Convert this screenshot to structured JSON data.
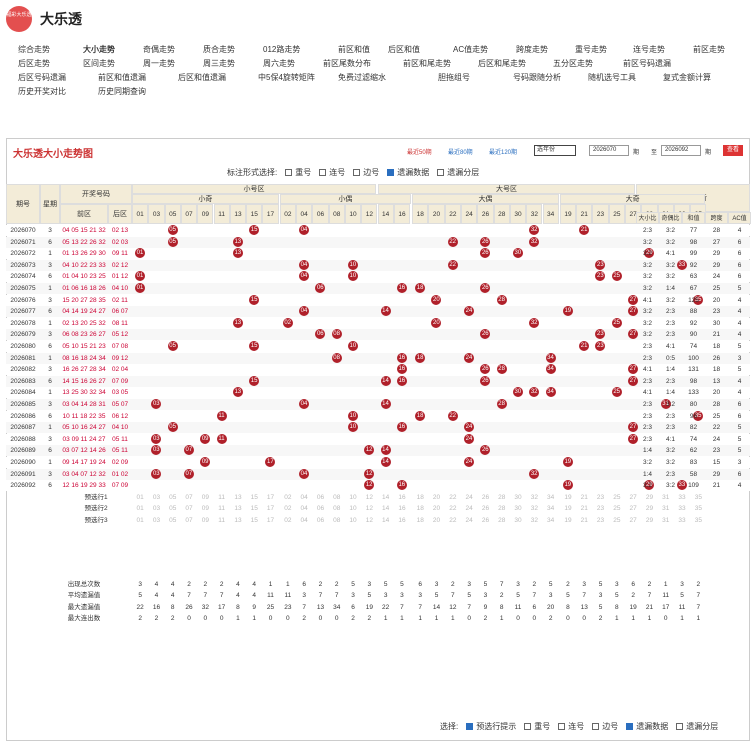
{
  "header": {
    "logo_text": "福彩大乐透",
    "title": "大乐透"
  },
  "nav": [
    [
      "综合走势",
      "大小走势",
      "奇偶走势",
      "质合走势",
      "012路走势",
      "前区和值",
      "后区和值",
      "AC值走势",
      "跨度走势",
      "重号走势",
      "连号走势",
      "前区走势"
    ],
    [
      "后区走势",
      "区间走势",
      "周一走势",
      "周三走势",
      "周六走势",
      "前区尾数分布",
      "前区和尾走势",
      "后区和尾走势",
      "五分区走势",
      "前区号码遗漏"
    ],
    [
      "后区号码遗漏",
      "前区和值遗漏",
      "后区和值遗漏",
      "中5保4旋转矩阵",
      "免费过滤缩水",
      "胆拖组号",
      "号码跟随分析",
      "随机选号工具",
      "复式金额计算"
    ],
    [
      "历史开奖对比",
      "历史同期查询"
    ]
  ],
  "panel": {
    "title": "大乐透大小走势图",
    "recent": [
      "最近50期",
      "最近80期",
      "最近120期"
    ],
    "year": "选年份",
    "from": "2026070",
    "period": "期",
    "to_label": "至",
    "to": "2026092",
    "period2": "期",
    "query": "查看",
    "options_label": "标注形式选择:",
    "options": [
      "重号",
      "连号",
      "边号",
      "遗漏数据",
      "遗漏分层"
    ],
    "bottom_label": "选择:",
    "bottom_options": [
      "预选行提示",
      "重号",
      "连号",
      "边号",
      "遗漏数据",
      "遗漏分层"
    ]
  },
  "table": {
    "head_groups": {
      "small": "小号区",
      "big": "大号区",
      "analysis": "前区分析",
      "draw": "开奖号码",
      "issue": "期号",
      "week": "星期",
      "front": "前区",
      "back": "后区"
    },
    "sub_groups": [
      "小奇",
      "小偶",
      "大偶",
      "大奇"
    ],
    "analysis_cols": [
      "大小比",
      "奇偶比",
      "和值",
      "跨度",
      "AC值"
    ],
    "numbers": [
      "01",
      "03",
      "05",
      "07",
      "09",
      "11",
      "13",
      "15",
      "17",
      "02",
      "04",
      "06",
      "08",
      "10",
      "12",
      "14",
      "16",
      "18",
      "20",
      "22",
      "24",
      "26",
      "28",
      "30",
      "32",
      "34",
      "19",
      "21",
      "23",
      "25",
      "27",
      "29",
      "31",
      "33",
      "35"
    ],
    "rows": [
      [
        "2026070",
        "3",
        "04 05 15 21 32",
        "02 13",
        "2:3",
        "3:2",
        "77",
        "28",
        "4"
      ],
      [
        "2026071",
        "6",
        "05 13 22 26 32",
        "02 03",
        "3:2",
        "3:2",
        "98",
        "27",
        "6"
      ],
      [
        "2026072",
        "1",
        "01 13 26 29 30",
        "09 11",
        "3:2",
        "4:1",
        "99",
        "29",
        "6"
      ],
      [
        "2026073",
        "3",
        "04 10 22 23 33",
        "02 12",
        "3:2",
        "3:2",
        "92",
        "29",
        "6"
      ],
      [
        "2026074",
        "6",
        "01 04 10 23 25",
        "01 12",
        "3:2",
        "3:2",
        "63",
        "24",
        "6"
      ],
      [
        "2026075",
        "1",
        "01 06 16 18 26",
        "04 10",
        "3:2",
        "1:4",
        "67",
        "25",
        "5"
      ],
      [
        "2026076",
        "3",
        "15 20 27 28 35",
        "02 11",
        "4:1",
        "3:2",
        "125",
        "20",
        "4"
      ],
      [
        "2026077",
        "6",
        "04 14 19 24 27",
        "06 07",
        "3:2",
        "2:3",
        "88",
        "23",
        "4"
      ],
      [
        "2026078",
        "1",
        "02 13 20 25 32",
        "08 11",
        "3:2",
        "2:3",
        "92",
        "30",
        "4"
      ],
      [
        "2026079",
        "3",
        "06 08 23 26 27",
        "05 12",
        "3:2",
        "2:3",
        "90",
        "21",
        "4"
      ],
      [
        "2026080",
        "6",
        "05 10 15 21 23",
        "07 08",
        "2:3",
        "4:1",
        "74",
        "18",
        "5"
      ],
      [
        "2026081",
        "1",
        "08 16 18 24 34",
        "09 12",
        "2:3",
        "0:5",
        "100",
        "26",
        "3"
      ],
      [
        "2026082",
        "3",
        "16 26 27 28 34",
        "02 04",
        "4:1",
        "1:4",
        "131",
        "18",
        "5"
      ],
      [
        "2026083",
        "6",
        "14 15 16 26 27",
        "07 09",
        "2:3",
        "2:3",
        "98",
        "13",
        "4"
      ],
      [
        "2026084",
        "1",
        "13 25 30 32 34",
        "03 05",
        "4:1",
        "1:4",
        "133",
        "20",
        "4"
      ],
      [
        "2026085",
        "3",
        "03 04 14 28 31",
        "05 07",
        "2:3",
        "3:2",
        "80",
        "28",
        "6"
      ],
      [
        "2026086",
        "6",
        "10 11 18 22 35",
        "06 12",
        "2:3",
        "2:3",
        "96",
        "25",
        "6"
      ],
      [
        "2026087",
        "1",
        "05 10 16 24 27",
        "04 10",
        "2:3",
        "2:3",
        "82",
        "22",
        "5"
      ],
      [
        "2026088",
        "3",
        "03 09 11 24 27",
        "05 11",
        "2:3",
        "4:1",
        "74",
        "24",
        "5"
      ],
      [
        "2026089",
        "6",
        "03 07 12 14 26",
        "05 11",
        "1:4",
        "3:2",
        "62",
        "23",
        "5"
      ],
      [
        "2026090",
        "1",
        "09 14 17 19 24",
        "02 09",
        "3:2",
        "3:2",
        "83",
        "15",
        "3"
      ],
      [
        "2026091",
        "3",
        "03 04 07 12 32",
        "01 02",
        "1:4",
        "2:3",
        "58",
        "29",
        "6"
      ],
      [
        "2026092",
        "6",
        "12 16 19 29 33",
        "07 09",
        "3:2",
        "3:2",
        "109",
        "21",
        "4"
      ]
    ],
    "preselect": [
      "预选行1",
      "预选行2",
      "预选行3"
    ],
    "stats": [
      {
        "label": "出现总次数",
        "v": [
          "3",
          "4",
          "4",
          "2",
          "2",
          "2",
          "4",
          "4",
          "1",
          "1",
          "6",
          "2",
          "2",
          "5",
          "3",
          "5",
          "5",
          "6",
          "3",
          "2",
          "3",
          "5",
          "7",
          "3",
          "2",
          "5",
          "2",
          "3",
          "5",
          "3",
          "6",
          "2",
          "1",
          "3",
          "2"
        ]
      },
      {
        "label": "平均遗漏值",
        "v": [
          "5",
          "4",
          "4",
          "7",
          "7",
          "7",
          "4",
          "4",
          "11",
          "11",
          "3",
          "7",
          "7",
          "3",
          "5",
          "3",
          "3",
          "3",
          "5",
          "7",
          "5",
          "3",
          "2",
          "5",
          "7",
          "3",
          "5",
          "7",
          "3",
          "5",
          "2",
          "7",
          "11",
          "5",
          "7"
        ]
      },
      {
        "label": "最大遗漏值",
        "v": [
          "22",
          "16",
          "8",
          "26",
          "32",
          "17",
          "8",
          "9",
          "25",
          "23",
          "7",
          "13",
          "34",
          "6",
          "19",
          "22",
          "7",
          "7",
          "14",
          "12",
          "7",
          "9",
          "8",
          "11",
          "6",
          "20",
          "8",
          "13",
          "5",
          "8",
          "19",
          "21",
          "17",
          "11",
          "7"
        ]
      },
      {
        "label": "最大连出数",
        "v": [
          "2",
          "2",
          "2",
          "0",
          "0",
          "0",
          "1",
          "1",
          "0",
          "0",
          "2",
          "0",
          "0",
          "2",
          "2",
          "1",
          "1",
          "1",
          "1",
          "1",
          "0",
          "2",
          "1",
          "0",
          "0",
          "2",
          "0",
          "0",
          "2",
          "1",
          "1",
          "1",
          "0",
          "1",
          "1"
        ]
      }
    ]
  }
}
